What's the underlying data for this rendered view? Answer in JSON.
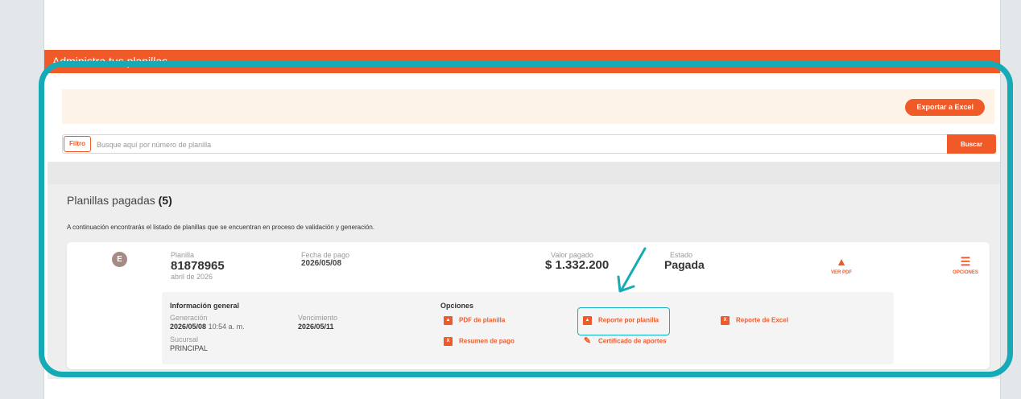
{
  "header": {
    "title": "Administra tus planillas"
  },
  "toolbar": {
    "export_label": "Exportar a Excel"
  },
  "filter": {
    "tag_label": "Filtro",
    "placeholder": "Busque aquí por número de planilla",
    "search_label": "Buscar"
  },
  "section": {
    "title": "Planillas pagadas",
    "count": "(5)",
    "description": "A continuación encontrarás el listado de planillas que se encuentran en proceso de validación y generación."
  },
  "planilla": {
    "avatar_letter": "E",
    "number_label": "Planilla",
    "number": "81878965",
    "period": "abril de 2026",
    "pay_date_label": "Fecha de pago",
    "pay_date": "2026/05/08",
    "amount_label": "Valor pagado",
    "amount": "$ 1.332.200",
    "status_label": "Estado",
    "status": "Pagada",
    "view_pdf_label": "VER PDF",
    "options_label": "OPCIONES"
  },
  "details": {
    "general_title": "Información general",
    "generation_label": "Generación",
    "generation_date": "2026/05/08",
    "generation_time": "10:54 a. m.",
    "due_label": "Vencimiento",
    "due_date": "2026/05/11",
    "branch_label": "Sucursal",
    "branch": "PRINCIPAL",
    "options_title": "Opciones",
    "options": {
      "pdf_planilla": "PDF de planilla",
      "reporte_planilla": "Reporte por planilla",
      "reporte_excel": "Reporte de Excel",
      "resumen_pago": "Resumen de pago",
      "certificado": "Certificado de aportes"
    }
  },
  "colors": {
    "brand": "#f05a28",
    "annotation": "#16aab7",
    "band": "#fdf3e7"
  },
  "icons": [
    "pdf-icon",
    "sliders-icon",
    "excel-icon",
    "pencil-icon"
  ]
}
